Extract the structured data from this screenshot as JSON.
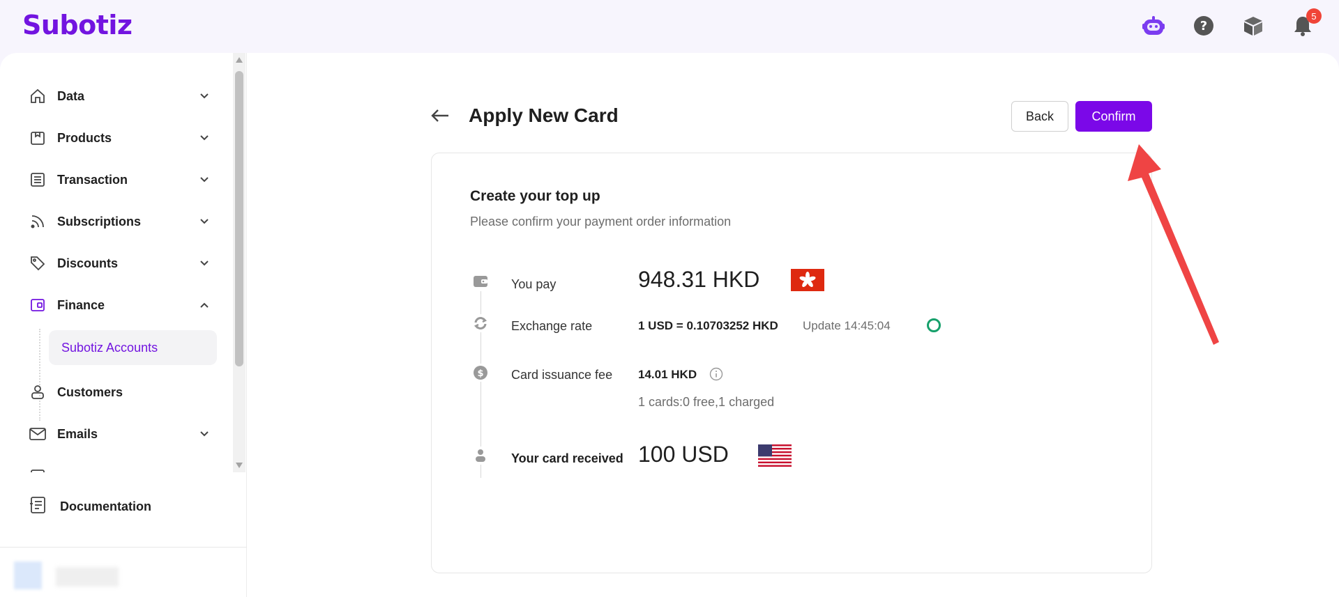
{
  "app": {
    "logo_text": "Subotiz",
    "brand_color": "#7214e0",
    "accent_button_color": "#7b08e8"
  },
  "topbar": {
    "icons": [
      "assistant-bot-icon",
      "help-icon",
      "package-icon",
      "bell-icon"
    ],
    "notification_count": "5"
  },
  "sidebar": {
    "items": [
      {
        "label": "Data",
        "icon": "home-icon",
        "expanded": false
      },
      {
        "label": "Products",
        "icon": "shop-icon",
        "expanded": false
      },
      {
        "label": "Transaction",
        "icon": "list-icon",
        "expanded": false
      },
      {
        "label": "Subscriptions",
        "icon": "rss-icon",
        "expanded": false
      },
      {
        "label": "Discounts",
        "icon": "tag-icon",
        "expanded": false
      },
      {
        "label": "Finance",
        "icon": "wallet-icon",
        "expanded": true
      },
      {
        "label": "Customers",
        "icon": "user-icon",
        "expanded": false
      },
      {
        "label": "Emails",
        "icon": "mail-icon",
        "expanded": false
      }
    ],
    "active_sub_item": "Subotiz Accounts",
    "documentation_label": "Documentation"
  },
  "page": {
    "title": "Apply New Card",
    "back_button": "Back",
    "confirm_button": "Confirm"
  },
  "card": {
    "title": "Create your top up",
    "subtitle": "Please confirm your payment order information",
    "you_pay": {
      "label": "You pay",
      "amount": "948.31 HKD",
      "flag": "hong-kong-flag-icon"
    },
    "exchange_rate": {
      "label": "Exchange rate",
      "value": "1 USD = 0.10703252 HKD",
      "update": "Update 14:45:04"
    },
    "card_fee": {
      "label": "Card issuance fee",
      "value": "14.01 HKD",
      "note": "1 cards:0 free,1 charged"
    },
    "received": {
      "label": "Your card received",
      "amount": "100 USD",
      "flag": "us-flag-icon"
    }
  }
}
